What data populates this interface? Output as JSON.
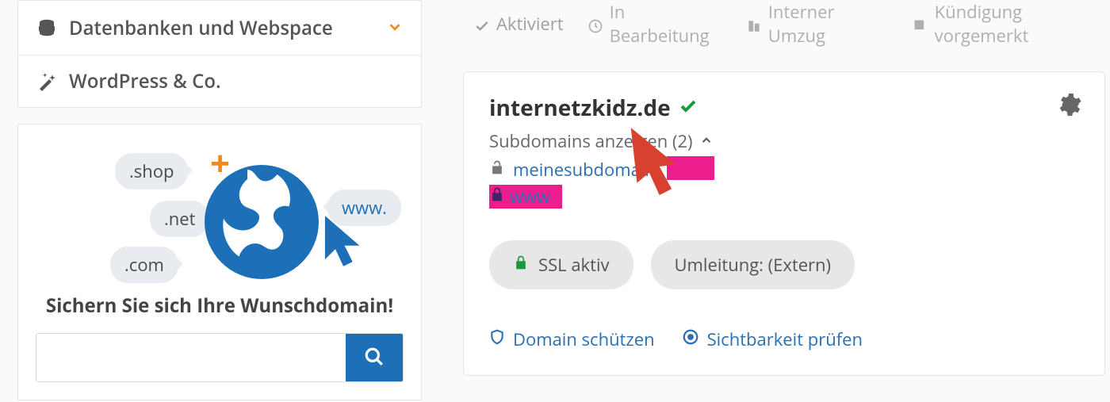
{
  "sidebar": {
    "items": [
      {
        "label": "Datenbanken und Webspace"
      },
      {
        "label": "WordPress & Co."
      }
    ]
  },
  "promo": {
    "tlds": {
      "shop": ".shop",
      "net": ".net",
      "com": ".com",
      "www": "www."
    },
    "headline": "Sichern Sie sich Ihre Wunschdomain!",
    "search_placeholder": ""
  },
  "status_filters": {
    "activated": "Aktiviert",
    "in_progress": "In Bearbeitung",
    "internal_move": "Interner Umzug",
    "cancel_queued": "Kündigung vorgemerkt"
  },
  "domain_card": {
    "domain": "internetzkidz.de",
    "sub_toggle_label": "Subdomains anzeigen (2)",
    "subdomains": [
      {
        "name": "meinesubdomain"
      },
      {
        "name": "www"
      }
    ],
    "badges": {
      "ssl": "SSL aktiv",
      "redirect": "Umleitung: (Extern)"
    },
    "links": {
      "protect": "Domain schützen",
      "visibility": "Sichtbarkeit prüfen"
    }
  }
}
